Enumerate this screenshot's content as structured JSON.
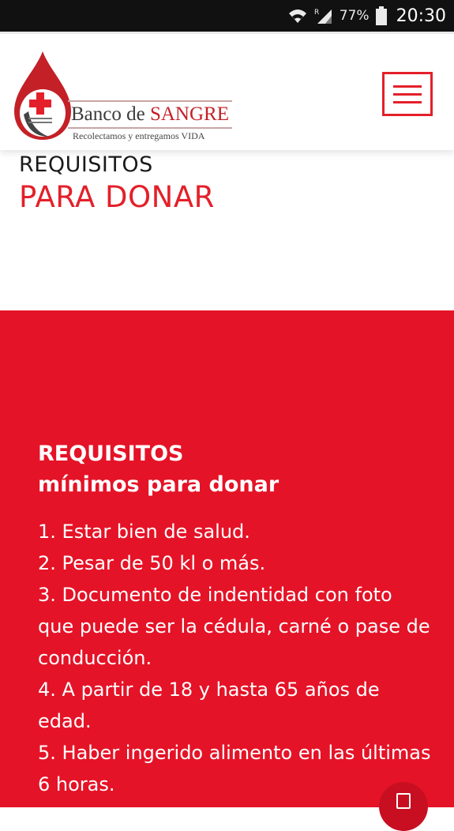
{
  "status_bar": {
    "battery_percent": "77%",
    "time": "20:30",
    "signal_label": "R"
  },
  "header": {
    "logo": {
      "title_prefix": "Banco de ",
      "title_accent": "SANGRE",
      "tagline": "Recolectamos y entregamos VIDA"
    },
    "menu_icon": "hamburger-menu-icon"
  },
  "page_title": {
    "line1": "REQUISITOS",
    "line2": "PARA DONAR"
  },
  "requirements": {
    "heading_line1": "REQUISITOS",
    "heading_line2": "mínimos para donar",
    "items": [
      "1. Estar bien de salud.",
      "2. Pesar de 50 kl o más.",
      "3. Documento de indentidad con foto que puede ser la cédula, carné o pase de conducción.",
      "4. A partir de 18 y hasta 65 años de edad.",
      "5. Haber ingerido alimento en las últimas 6 horas."
    ]
  },
  "colors": {
    "brand_red": "#e3202a",
    "section_red": "#e51327",
    "status_bar": "#111111"
  }
}
